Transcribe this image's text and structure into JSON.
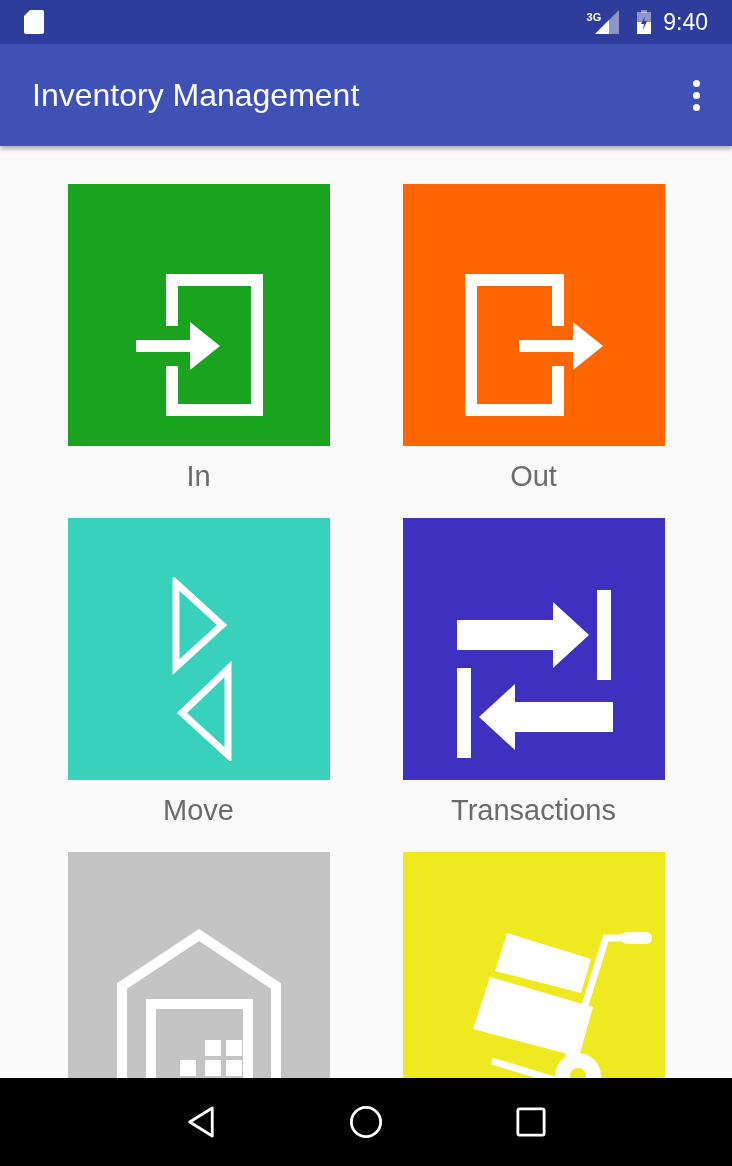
{
  "status_bar": {
    "network": "3G",
    "time": "9:40"
  },
  "app_bar": {
    "title": "Inventory Management"
  },
  "tiles": [
    {
      "kind": "in",
      "label": "In",
      "color": "#1aa31e"
    },
    {
      "kind": "out",
      "label": "Out",
      "color": "#ff6600"
    },
    {
      "kind": "move",
      "label": "Move",
      "color": "#38d1bb"
    },
    {
      "kind": "transactions",
      "label": "Transactions",
      "color": "#3e31c0"
    },
    {
      "kind": "warehouse",
      "color": "#c4c4c4"
    },
    {
      "kind": "cart",
      "color": "#efe920"
    }
  ]
}
